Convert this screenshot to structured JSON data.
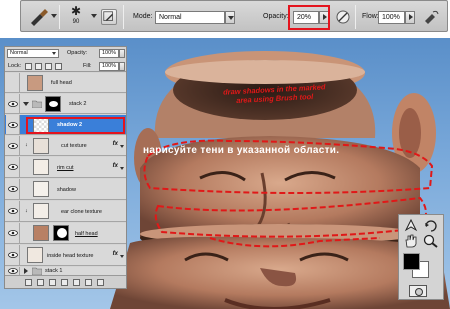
{
  "options_bar": {
    "brush_size": "90",
    "mode_label": "Mode:",
    "mode_value": "Normal",
    "opacity_label": "Opacity:",
    "opacity_value": "20%",
    "flow_label": "Flow:",
    "flow_value": "100%"
  },
  "layers_panel": {
    "blend_mode": "Normal",
    "opacity_label": "Opacity:",
    "opacity_value": "100%",
    "lock_label": "Lock:",
    "fill_label": "Fill:",
    "fill_value": "100%",
    "layers": [
      {
        "name": "full head"
      },
      {
        "name": "stack 2"
      },
      {
        "name": "shadow 2"
      },
      {
        "name": "cut texture"
      },
      {
        "name": "rim cut"
      },
      {
        "name": "shadow"
      },
      {
        "name": "ear clone texture"
      },
      {
        "name": "half head"
      },
      {
        "name": "inside head texture"
      },
      {
        "name": "stack 1"
      }
    ],
    "fx_label": "fx"
  },
  "annotations": {
    "english": "draw shadows in the marked area using Brush tool",
    "russian": "нарисуйте тени в указанной области."
  },
  "colors": {
    "highlight": "#e4141e",
    "selected_layer": "#3a7fd9",
    "annotation_text": "#e01818"
  }
}
